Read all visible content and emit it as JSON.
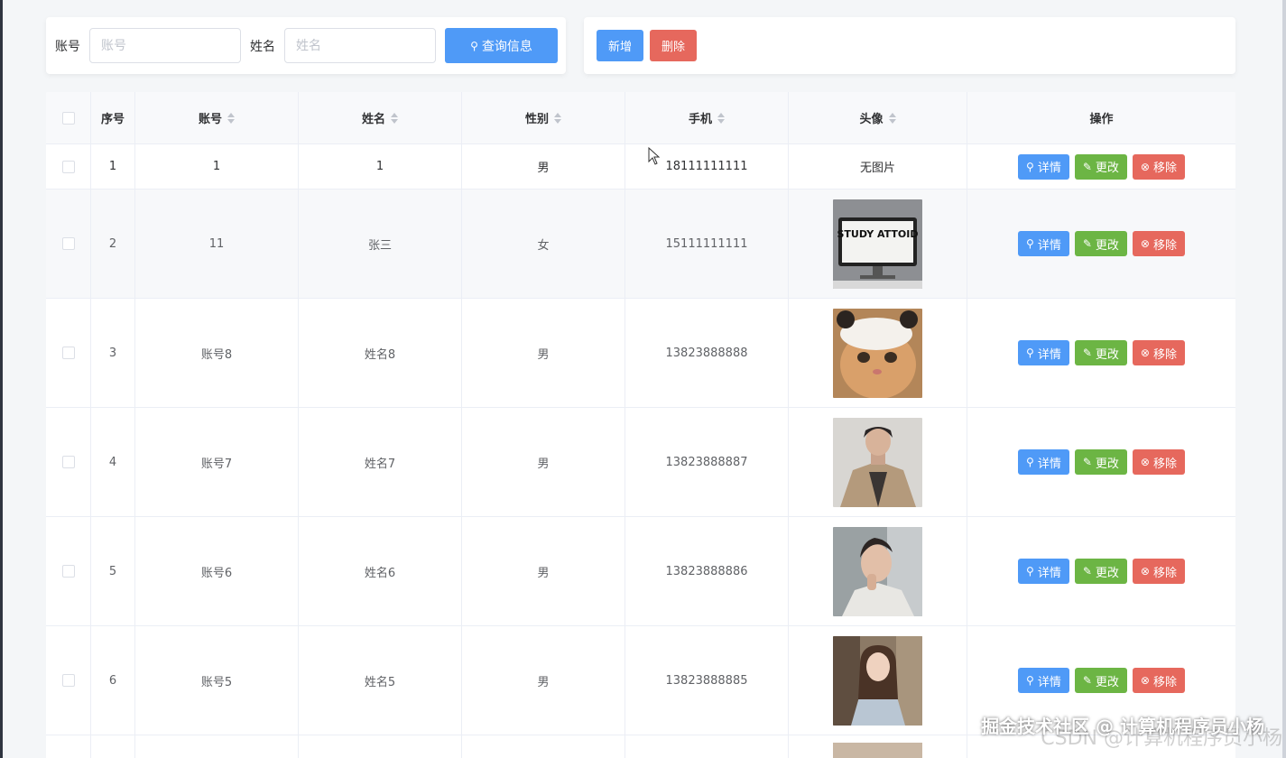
{
  "search": {
    "account_label": "账号",
    "account_placeholder": "账号",
    "name_label": "姓名",
    "name_placeholder": "姓名",
    "query_button": "查询信息"
  },
  "actions": {
    "add_button": "新增",
    "delete_button": "删除"
  },
  "table": {
    "headers": [
      "序号",
      "账号",
      "姓名",
      "性别",
      "手机",
      "头像",
      "操作"
    ],
    "buttons": {
      "detail": "详情",
      "edit": "更改",
      "remove": "移除"
    },
    "rows": [
      {
        "index": "1",
        "account": "1",
        "name": "1",
        "gender": "男",
        "phone": "18111111111",
        "avatar_text": "无图片",
        "avatar": "none"
      },
      {
        "index": "2",
        "account": "11",
        "name": "张三",
        "gender": "女",
        "phone": "15111111111",
        "avatar_text": "STUDY ATTOID",
        "avatar": "study-monitor-image"
      },
      {
        "index": "3",
        "account": "账号8",
        "name": "姓名8",
        "gender": "男",
        "phone": "13823888888",
        "avatar": "cat-photo"
      },
      {
        "index": "4",
        "account": "账号7",
        "name": "姓名7",
        "gender": "男",
        "phone": "13823888887",
        "avatar": "man-coat-photo"
      },
      {
        "index": "5",
        "account": "账号6",
        "name": "姓名6",
        "gender": "男",
        "phone": "13823888886",
        "avatar": "man-portrait-photo"
      },
      {
        "index": "6",
        "account": "账号5",
        "name": "姓名5",
        "gender": "男",
        "phone": "13823888885",
        "avatar": "woman-street-photo"
      }
    ]
  },
  "watermark": {
    "primary": "掘金技术社区 @ 计算机程序员小杨",
    "secondary": "CSDN @计算机程序员小杨"
  },
  "colors": {
    "primary": "#4f9af7",
    "success": "#6cb544",
    "danger": "#e6685d"
  }
}
